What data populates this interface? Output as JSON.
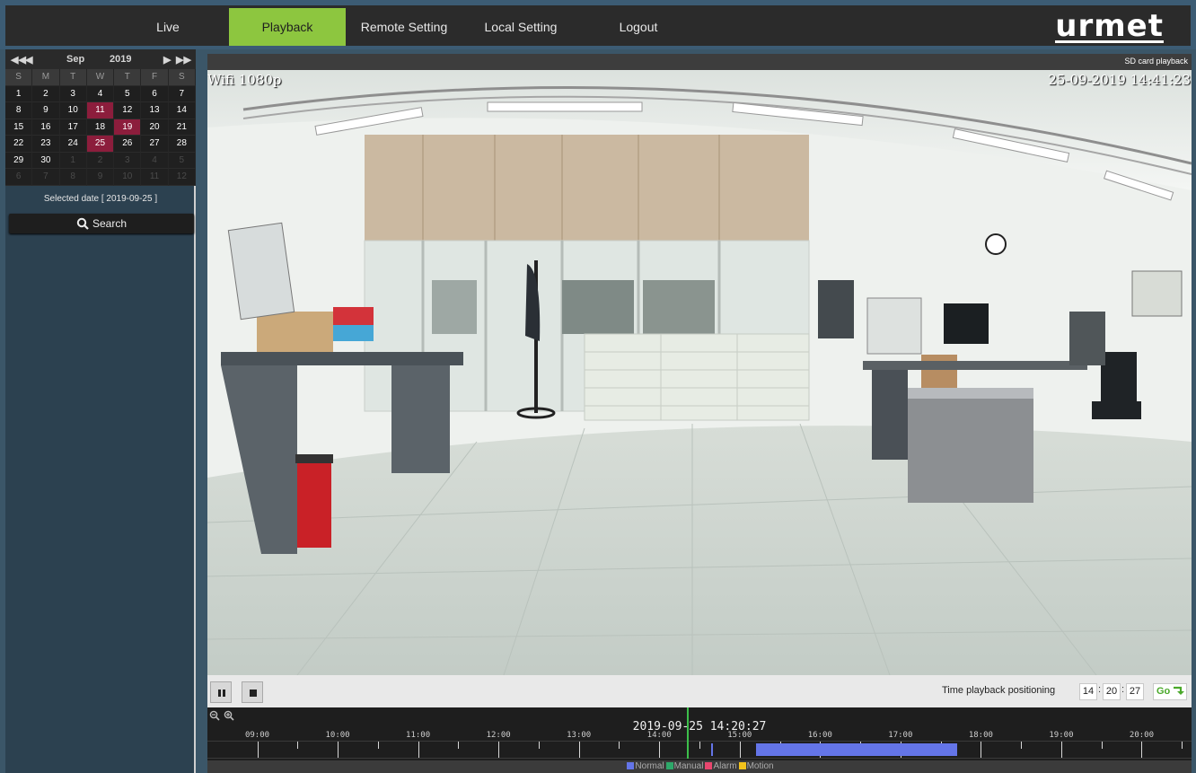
{
  "nav": {
    "items": [
      {
        "label": "Live",
        "active": false
      },
      {
        "label": "Playback",
        "active": true
      },
      {
        "label": "Remote Setting",
        "active": false
      },
      {
        "label": "Local Setting",
        "active": false
      },
      {
        "label": "Logout",
        "active": false
      }
    ],
    "logo_text": "urmet"
  },
  "calendar": {
    "month": "Sep",
    "year": "2019",
    "prev_year_icon": "double-left-arrow-icon",
    "prev_month_icon": "left-arrow-icon",
    "next_month_icon": "right-arrow-icon",
    "next_year_icon": "double-right-arrow-icon",
    "weekday_headers": [
      "S",
      "M",
      "T",
      "W",
      "T",
      "F",
      "S"
    ],
    "weeks": [
      [
        {
          "d": "1"
        },
        {
          "d": "2"
        },
        {
          "d": "3"
        },
        {
          "d": "4"
        },
        {
          "d": "5"
        },
        {
          "d": "6"
        },
        {
          "d": "7"
        }
      ],
      [
        {
          "d": "8"
        },
        {
          "d": "9"
        },
        {
          "d": "10"
        },
        {
          "d": "11",
          "rec": true
        },
        {
          "d": "12"
        },
        {
          "d": "13"
        },
        {
          "d": "14"
        }
      ],
      [
        {
          "d": "15"
        },
        {
          "d": "16"
        },
        {
          "d": "17"
        },
        {
          "d": "18"
        },
        {
          "d": "19",
          "rec": true
        },
        {
          "d": "20"
        },
        {
          "d": "21"
        }
      ],
      [
        {
          "d": "22"
        },
        {
          "d": "23"
        },
        {
          "d": "24"
        },
        {
          "d": "25",
          "rec": true
        },
        {
          "d": "26"
        },
        {
          "d": "27"
        },
        {
          "d": "28"
        }
      ],
      [
        {
          "d": "29"
        },
        {
          "d": "30"
        },
        {
          "d": "1",
          "other": true
        },
        {
          "d": "2",
          "other": true
        },
        {
          "d": "3",
          "other": true
        },
        {
          "d": "4",
          "other": true
        },
        {
          "d": "5",
          "other": true
        }
      ],
      [
        {
          "d": "6",
          "other": true
        },
        {
          "d": "7",
          "other": true
        },
        {
          "d": "8",
          "other": true
        },
        {
          "d": "9",
          "other": true
        },
        {
          "d": "10",
          "other": true
        },
        {
          "d": "11",
          "other": true
        },
        {
          "d": "12",
          "other": true
        }
      ]
    ],
    "selected_date_text": "Selected date [ 2019-09-25 ]",
    "search_label": "Search",
    "record_color": "#8c1d3c"
  },
  "video": {
    "source_label": "SD card playback",
    "osd_name": "Wifi 1080p",
    "osd_timestamp": "25-09-2019 14:41:23"
  },
  "controls": {
    "pause_icon": "pause-icon",
    "stop_icon": "stop-icon",
    "time_positioning_label": "Time playback positioning",
    "hour": "14",
    "minute": "20",
    "second": "27",
    "go_label": "Go"
  },
  "timeline": {
    "current_time": "2019-09-25 14:20:27",
    "tick_labels": [
      "09:00",
      "10:00",
      "11:00",
      "12:00",
      "13:00",
      "14:00",
      "15:00",
      "16:00",
      "17:00",
      "18:00",
      "19:00",
      "20:00"
    ],
    "cursor_hour": 14.34,
    "recordings": [
      {
        "start_hour": 14.65,
        "end_hour": 14.67
      },
      {
        "start_hour": 15.2,
        "end_hour": 17.7
      }
    ],
    "recording_color": "#6475e8",
    "legend": [
      {
        "label": "Normal",
        "color": "#6475e8"
      },
      {
        "label": "Manual",
        "color": "#2ea86a"
      },
      {
        "label": "Alarm",
        "color": "#e8466e"
      },
      {
        "label": "Motion",
        "color": "#f2c21c"
      }
    ]
  }
}
